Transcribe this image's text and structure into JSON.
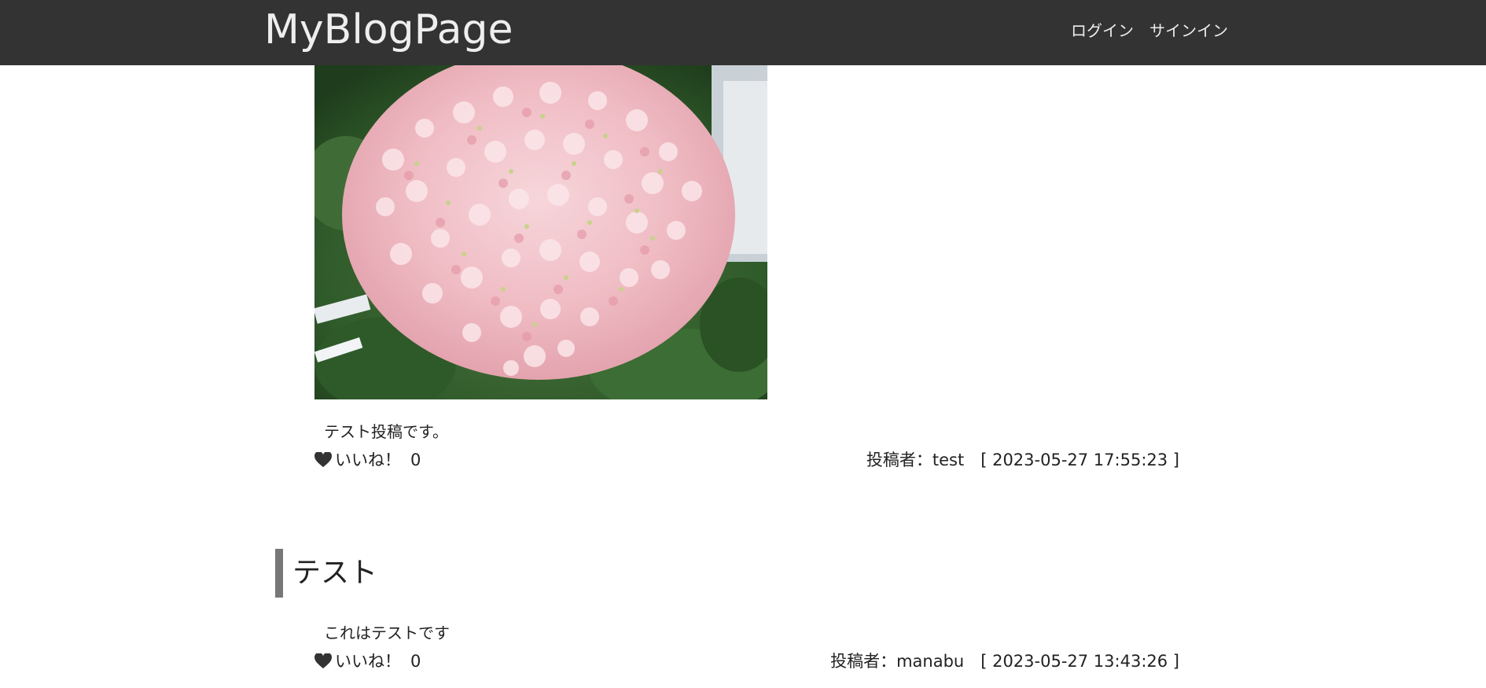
{
  "header": {
    "brand": "MyBlogPage",
    "nav": {
      "login": "ログイン",
      "signin": "サインイン"
    }
  },
  "posts": [
    {
      "body": "テスト投稿です。",
      "like_label": "いいね！",
      "like_count": "0",
      "meta": "投稿者：test　[ 2023-05-27 17:55:23 ]"
    },
    {
      "title": "テスト",
      "body": "これはテストです",
      "like_label": "いいね！",
      "like_count": "0",
      "meta": "投稿者：manabu　[ 2023-05-27 13:43:26 ]"
    }
  ],
  "icons": {
    "like": "heart-icon"
  },
  "colors": {
    "header_bg": "#333333",
    "title_accent": "#777777"
  }
}
